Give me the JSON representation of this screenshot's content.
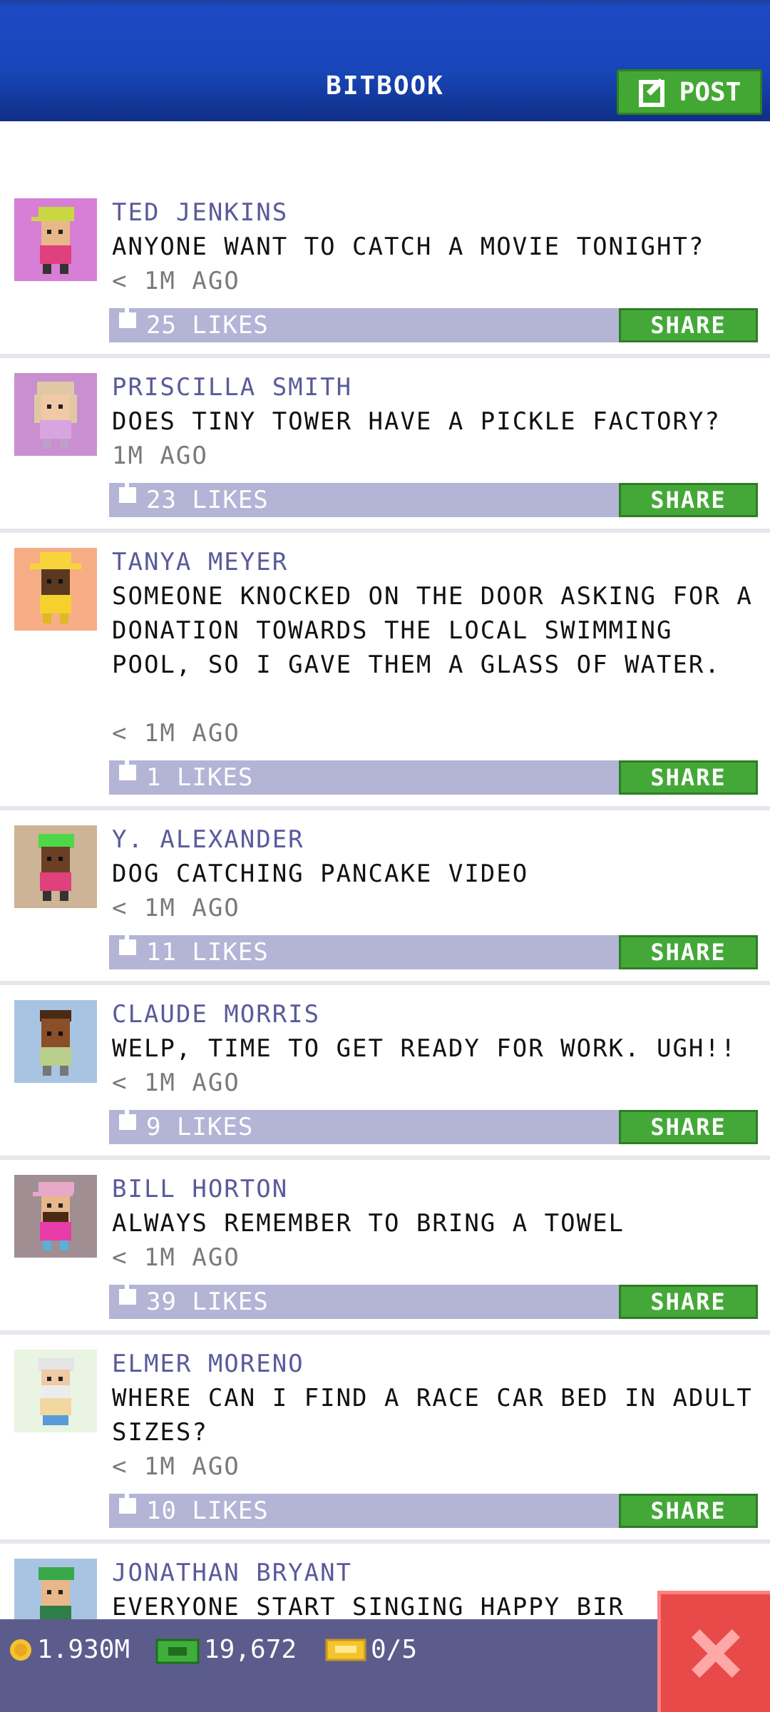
{
  "header": {
    "title": "BITBOOK",
    "post_label": "POST"
  },
  "posts": [
    {
      "author": "TED JENKINS",
      "message": "ANYONE WANT TO CATCH A MOVIE TONIGHT?",
      "time": "< 1M AGO",
      "likes": "25 LIKES",
      "share": "SHARE"
    },
    {
      "author": "PRISCILLA SMITH",
      "message": "DOES TINY TOWER HAVE A PICKLE FACTORY?",
      "time": "1M AGO",
      "likes": "23 LIKES",
      "share": "SHARE"
    },
    {
      "author": "TANYA MEYER",
      "message": "SOMEONE KNOCKED ON THE DOOR ASKING FOR A DONATION TOWARDS THE LOCAL SWIMMING POOL, SO I GAVE THEM A GLASS OF WATER.",
      "time": "< 1M AGO",
      "likes": "1 LIKES",
      "share": "SHARE"
    },
    {
      "author": "Y. ALEXANDER",
      "message": "DOG CATCHING PANCAKE VIDEO",
      "time": "< 1M AGO",
      "likes": "11 LIKES",
      "share": "SHARE"
    },
    {
      "author": "CLAUDE MORRIS",
      "message": "WELP, TIME TO GET READY FOR WORK. UGH!!",
      "time": "< 1M AGO",
      "likes": "9 LIKES",
      "share": "SHARE"
    },
    {
      "author": "BILL HORTON",
      "message": "ALWAYS REMEMBER TO BRING A TOWEL",
      "time": "< 1M AGO",
      "likes": "39 LIKES",
      "share": "SHARE"
    },
    {
      "author": "ELMER MORENO",
      "message": "WHERE CAN I FIND A RACE CAR BED IN ADULT SIZES?",
      "time": "< 1M AGO",
      "likes": "10 LIKES",
      "share": "SHARE"
    },
    {
      "author": "JONATHAN BRYANT",
      "message": "EVERYONE START SINGING HAPPY BIR"
    }
  ],
  "status": {
    "coins": "1.930M",
    "bux": "19,672",
    "tickets": "0/5"
  },
  "colors": {
    "header": "#1846b8",
    "accent_green": "#44a838",
    "likes_bar": "#b4b4d6",
    "author": "#5a5a9b",
    "bottom_bar": "#5c5c8c",
    "close": "#e84a4a"
  },
  "icons": {
    "post": "compose-icon",
    "like": "thumbs-up-icon",
    "coin": "coin-icon",
    "bux": "bux-icon",
    "ticket": "ticket-icon",
    "close": "close-icon"
  }
}
